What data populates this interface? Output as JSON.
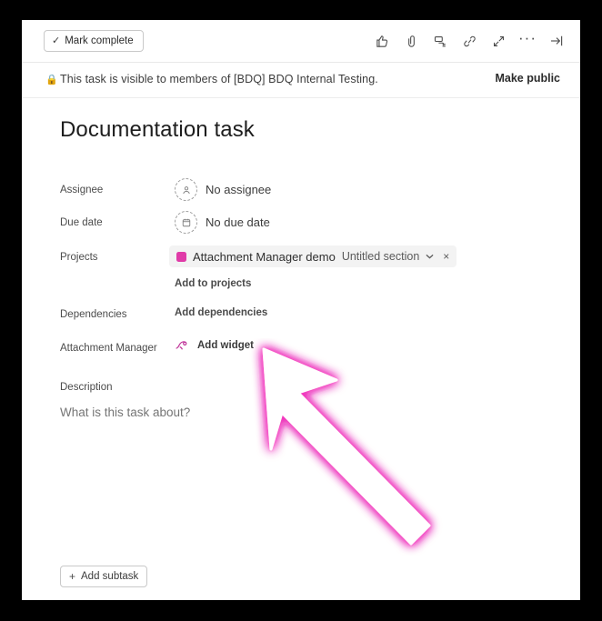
{
  "window": {
    "background_color": "#000000",
    "panel_color": "#ffffff"
  },
  "toolbar": {
    "mark_complete_label": "Mark complete",
    "mark_complete_icon": "check-icon",
    "icons": [
      {
        "name": "like-icon",
        "label": "Like"
      },
      {
        "name": "paperclip-icon",
        "label": "Attach"
      },
      {
        "name": "subtask-icon",
        "label": "Add subtask"
      },
      {
        "name": "link-icon",
        "label": "Copy task link"
      },
      {
        "name": "fullscreen-icon",
        "label": "Full screen"
      },
      {
        "name": "more-options-icon",
        "label": "More actions"
      },
      {
        "name": "close-pane-icon",
        "label": "Close details pane"
      }
    ],
    "dots_label": "···",
    "close_label": "→|"
  },
  "privacy_bar": {
    "lock_icon": "lock-icon",
    "text": "This task is visible to members of [BDQ] BDQ Internal Testing.",
    "make_public_label": "Make public"
  },
  "task": {
    "title": "Documentation task",
    "fields": {
      "assignee": {
        "label": "Assignee",
        "value": "No assignee",
        "icon": "person-avatar-icon"
      },
      "due_date": {
        "label": "Due date",
        "value": "No due date",
        "icon": "calendar-icon"
      },
      "projects": {
        "label": "Projects",
        "chip": {
          "swatch_color": "#e03ba8",
          "project_name": "Attachment Manager demo",
          "section_name": "Untitled section",
          "chevron": "⌄",
          "remove": "×"
        },
        "add_label": "Add to projects"
      },
      "dependencies": {
        "label": "Dependencies",
        "add_label": "Add dependencies"
      },
      "attachment_manager": {
        "label": "Attachment Manager",
        "icon": "widget-icon",
        "icon_color": "#c0379a",
        "add_label": "Add widget"
      },
      "description": {
        "label": "Description",
        "placeholder": "What is this task about?"
      }
    },
    "add_subtask_label": "Add subtask",
    "add_subtask_icon": "plus-icon"
  },
  "annotation": {
    "cursor_arrow": {
      "name": "annotation-arrow",
      "fill": "#ffffff",
      "glow_color": "#e520b0"
    }
  }
}
